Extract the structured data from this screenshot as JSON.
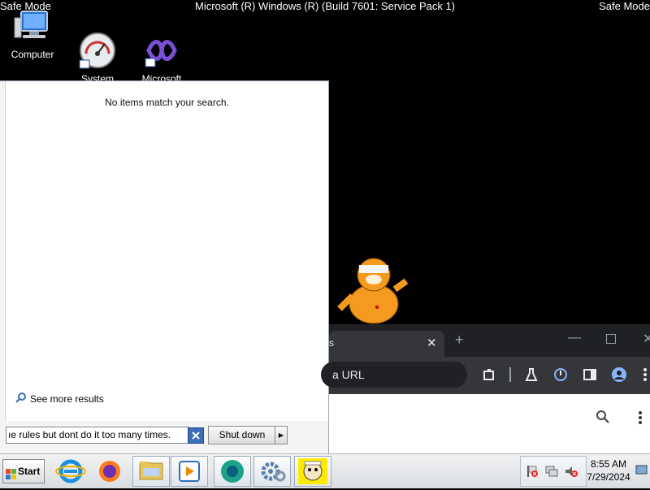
{
  "desktop": {
    "safe_mode_left": "Safe Mode",
    "safe_mode_right": "Safe Mode",
    "build_text": "Microsoft (R) Windows (R) (Build 7601: Service Pack 1)",
    "icons": [
      {
        "label": "Computer",
        "icon": "computer-icon"
      },
      {
        "label": "System\nBooster",
        "icon": "speedometer-icon"
      },
      {
        "label": "Microsoft\nVisual Stud...",
        "icon": "visual-studio-icon"
      }
    ]
  },
  "start_menu": {
    "no_items": "No items match your search.",
    "see_more": "See more results",
    "search_value": "ıe rules but dont do it too many times.",
    "shutdown_label": "Shut down"
  },
  "browser": {
    "tab_title": "s",
    "omnibox_text": "a URL"
  },
  "taskbar": {
    "start_label": "Start",
    "time": "8:55 AM",
    "date": "7/29/2024",
    "apps": [
      "internet-explorer-icon",
      "firefox-icon",
      "file-explorer-icon",
      "media-player-icon",
      "chrome-like-icon",
      "settings-gear-icon",
      "cartoon-cat-icon"
    ]
  },
  "colors": {
    "desktop_bg": "#000000",
    "taskbar_bg": "#e6e9ed",
    "browser_dark": "#35363a"
  }
}
